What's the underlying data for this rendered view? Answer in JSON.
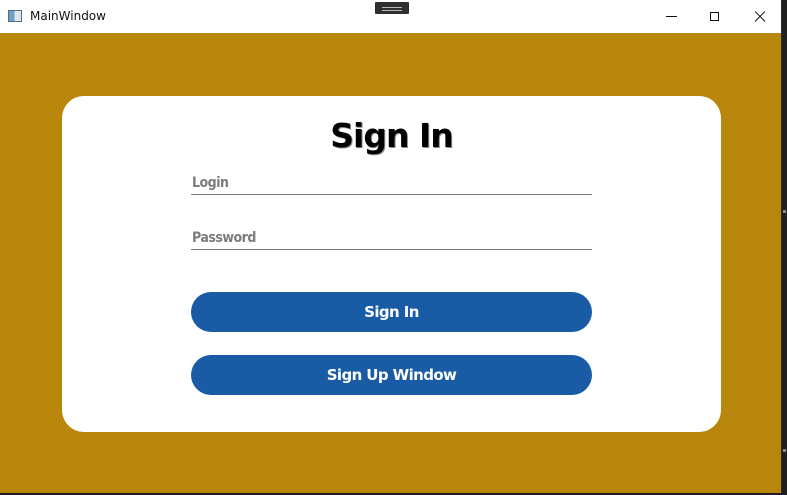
{
  "window": {
    "title": "MainWindow",
    "background_color": "#b8860b",
    "icons": {
      "app": "app-window-icon",
      "grip": "drag-grip-icon",
      "minimize": "minimize-icon",
      "maximize": "maximize-icon",
      "close": "close-icon"
    }
  },
  "form": {
    "heading": "Sign In",
    "login": {
      "placeholder": "Login",
      "value": ""
    },
    "password": {
      "placeholder": "Password",
      "value": ""
    },
    "signin_label": "Sign In",
    "signup_label": "Sign Up Window",
    "button_color": "#1a5ba6"
  }
}
